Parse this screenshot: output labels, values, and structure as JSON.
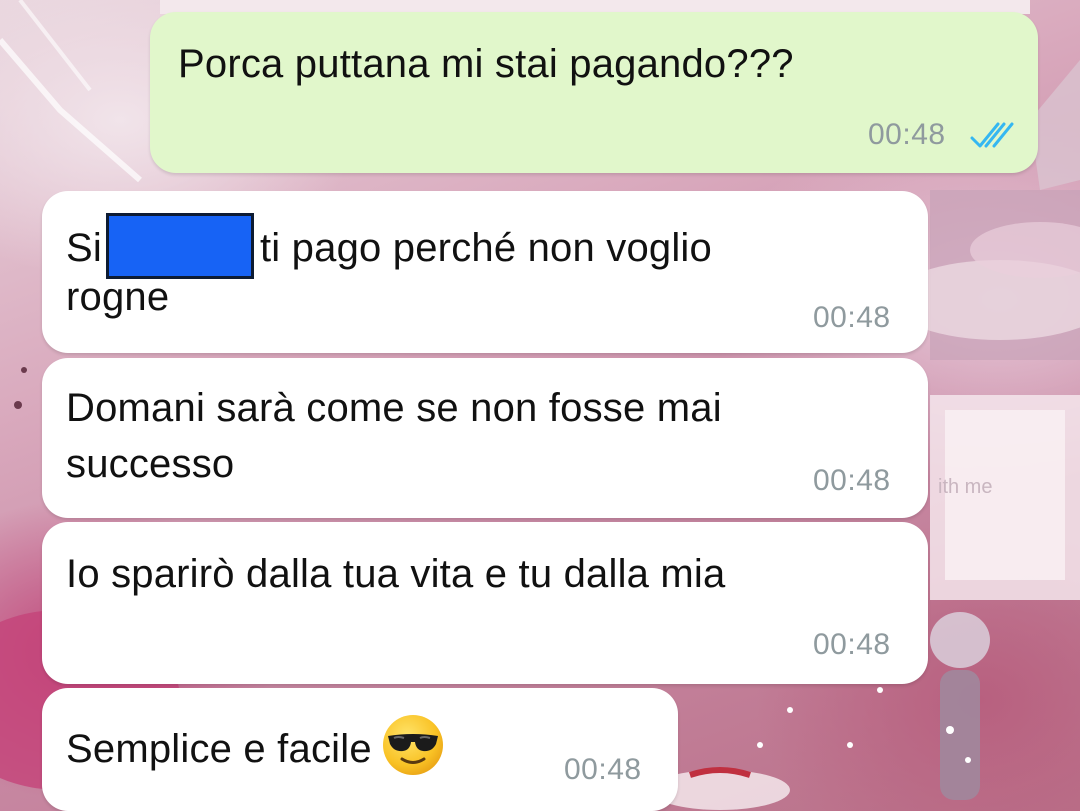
{
  "messages": [
    {
      "direction": "outgoing",
      "text": "Porca puttana mi stai pagando???",
      "time": "00:48",
      "status": "read"
    },
    {
      "direction": "incoming",
      "text_before": "Si",
      "text_after": "ti pago perché non voglio",
      "text_line2": "rogne",
      "time": "00:48"
    },
    {
      "direction": "incoming",
      "line1": "Domani sarà come se non fosse mai",
      "line2": "successo",
      "time": "00:48"
    },
    {
      "direction": "incoming",
      "text": "Io sparirò dalla tua vita e tu dalla mia",
      "time": "00:48"
    },
    {
      "direction": "incoming",
      "text": "Semplice e facile",
      "emoji": "smiling-face-with-sunglasses",
      "time": "00:48"
    }
  ],
  "wallpaper_text": "ith me",
  "colors": {
    "outgoing_bubble": "#e1f7cb",
    "incoming_bubble": "#ffffff",
    "read_ticks": "#34b7f1",
    "redaction": "#1763f5"
  }
}
